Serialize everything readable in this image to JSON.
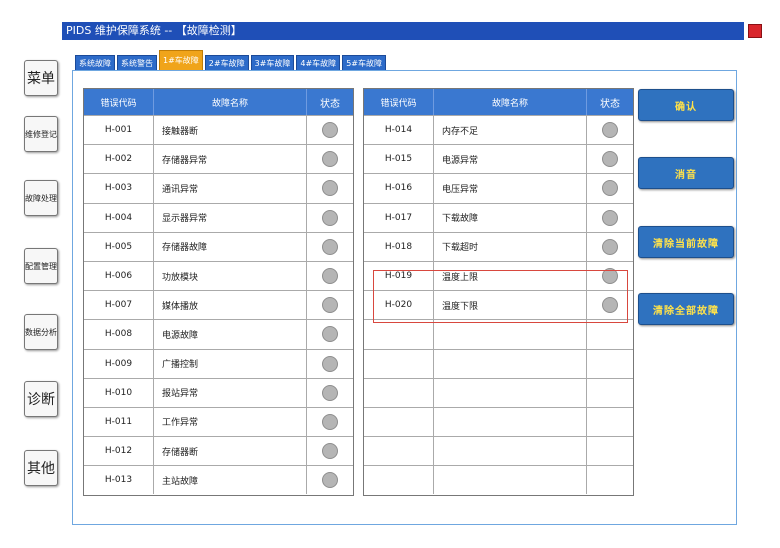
{
  "window": {
    "title": "PIDS 维护保障系统 -- 【故障检测】"
  },
  "sidebar": {
    "items": [
      "菜单",
      "维修登记",
      "故障处理",
      "配置管理",
      "数据分析",
      "诊断",
      "其他"
    ]
  },
  "tabs": [
    "系统故障",
    "系统警告",
    "1#车故障",
    "2#车故障",
    "3#车故障",
    "4#车故障",
    "5#车故障"
  ],
  "active_tab": 2,
  "table_headers": {
    "code": "错误代码",
    "name": "故障名称",
    "state": "状态"
  },
  "left_table": {
    "rows": [
      {
        "code": "H-001",
        "name": "接触器断"
      },
      {
        "code": "H-002",
        "name": "存储器异常"
      },
      {
        "code": "H-003",
        "name": "通讯异常"
      },
      {
        "code": "H-004",
        "name": "显示器异常"
      },
      {
        "code": "H-005",
        "name": "存储器故障"
      },
      {
        "code": "H-006",
        "name": "功放模块"
      },
      {
        "code": "H-007",
        "name": "媒体播放"
      },
      {
        "code": "H-008",
        "name": "电源故障"
      },
      {
        "code": "H-009",
        "name": "广播控制"
      },
      {
        "code": "H-010",
        "name": "报站异常"
      },
      {
        "code": "H-011",
        "name": "工作异常"
      },
      {
        "code": "H-012",
        "name": "存储器断"
      },
      {
        "code": "H-013",
        "name": "主站故障"
      }
    ]
  },
  "right_table": {
    "rows": [
      {
        "code": "H-014",
        "name": "内存不足"
      },
      {
        "code": "H-015",
        "name": "电源异常"
      },
      {
        "code": "H-016",
        "name": "电压异常"
      },
      {
        "code": "H-017",
        "name": "下载故障"
      },
      {
        "code": "H-018",
        "name": "下载超时"
      },
      {
        "code": "H-019",
        "name": "温度上限"
      },
      {
        "code": "H-020",
        "name": "温度下限"
      }
    ]
  },
  "actions": [
    "确认",
    "消音",
    "清除当前故障",
    "清除全部故障"
  ],
  "colors": {
    "title_bar": "#1f4fb7",
    "tab": "#2d6bc9",
    "tab_active": "#f0a41a",
    "header": "#3a78d0",
    "led_off": "#b5b5b5",
    "highlight": "#d8473e",
    "action_text": "#ffe24a"
  }
}
